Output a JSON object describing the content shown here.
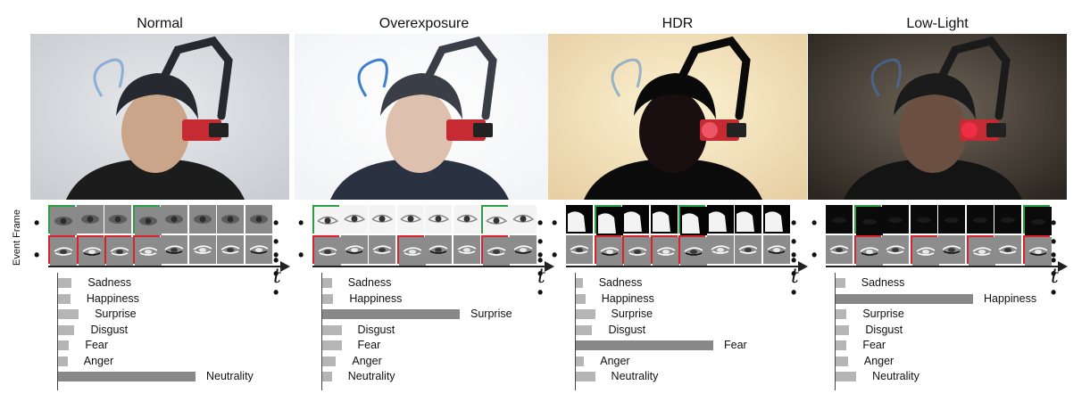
{
  "row_label": "Event Frame",
  "time_label": "t",
  "emotions": [
    "Sadness",
    "Happiness",
    "Surprise",
    "Disgust",
    "Fear",
    "Anger",
    "Neutrality"
  ],
  "colors": {
    "bar_light": "#b5b5b5",
    "bar_dark": "#888888",
    "green_box": "#2e9e44",
    "red_box": "#d9232a"
  },
  "panels": [
    {
      "title": "Normal",
      "scene": "normal",
      "values": [
        0.1,
        0.09,
        0.15,
        0.12,
        0.08,
        0.07,
        1.0
      ],
      "dominant": "Neutrality",
      "frames": "gray",
      "green_idx": [
        0,
        3
      ],
      "red_idx": [
        0,
        1,
        2,
        3
      ]
    },
    {
      "title": "Overexposure",
      "scene": "overexposure",
      "values": [
        0.07,
        0.08,
        1.0,
        0.14,
        0.14,
        0.1,
        0.07
      ],
      "dominant": "Surprise",
      "frames": "white",
      "green_idx": [
        0,
        6
      ],
      "red_idx": [
        0,
        3,
        6
      ]
    },
    {
      "title": "HDR",
      "scene": "hdr",
      "values": [
        0.05,
        0.07,
        0.14,
        0.12,
        1.0,
        0.06,
        0.14
      ],
      "dominant": "Fear",
      "frames": "dark",
      "green_idx": [
        1,
        4
      ],
      "red_idx": [
        1,
        2,
        3,
        4
      ]
    },
    {
      "title": "Low-Light",
      "scene": "lowlight",
      "values": [
        0.07,
        1.0,
        0.08,
        0.1,
        0.08,
        0.09,
        0.15
      ],
      "dominant": "Happiness",
      "frames": "black",
      "green_idx": [
        1,
        7
      ],
      "red_idx": [
        1,
        3,
        5,
        7
      ]
    }
  ]
}
